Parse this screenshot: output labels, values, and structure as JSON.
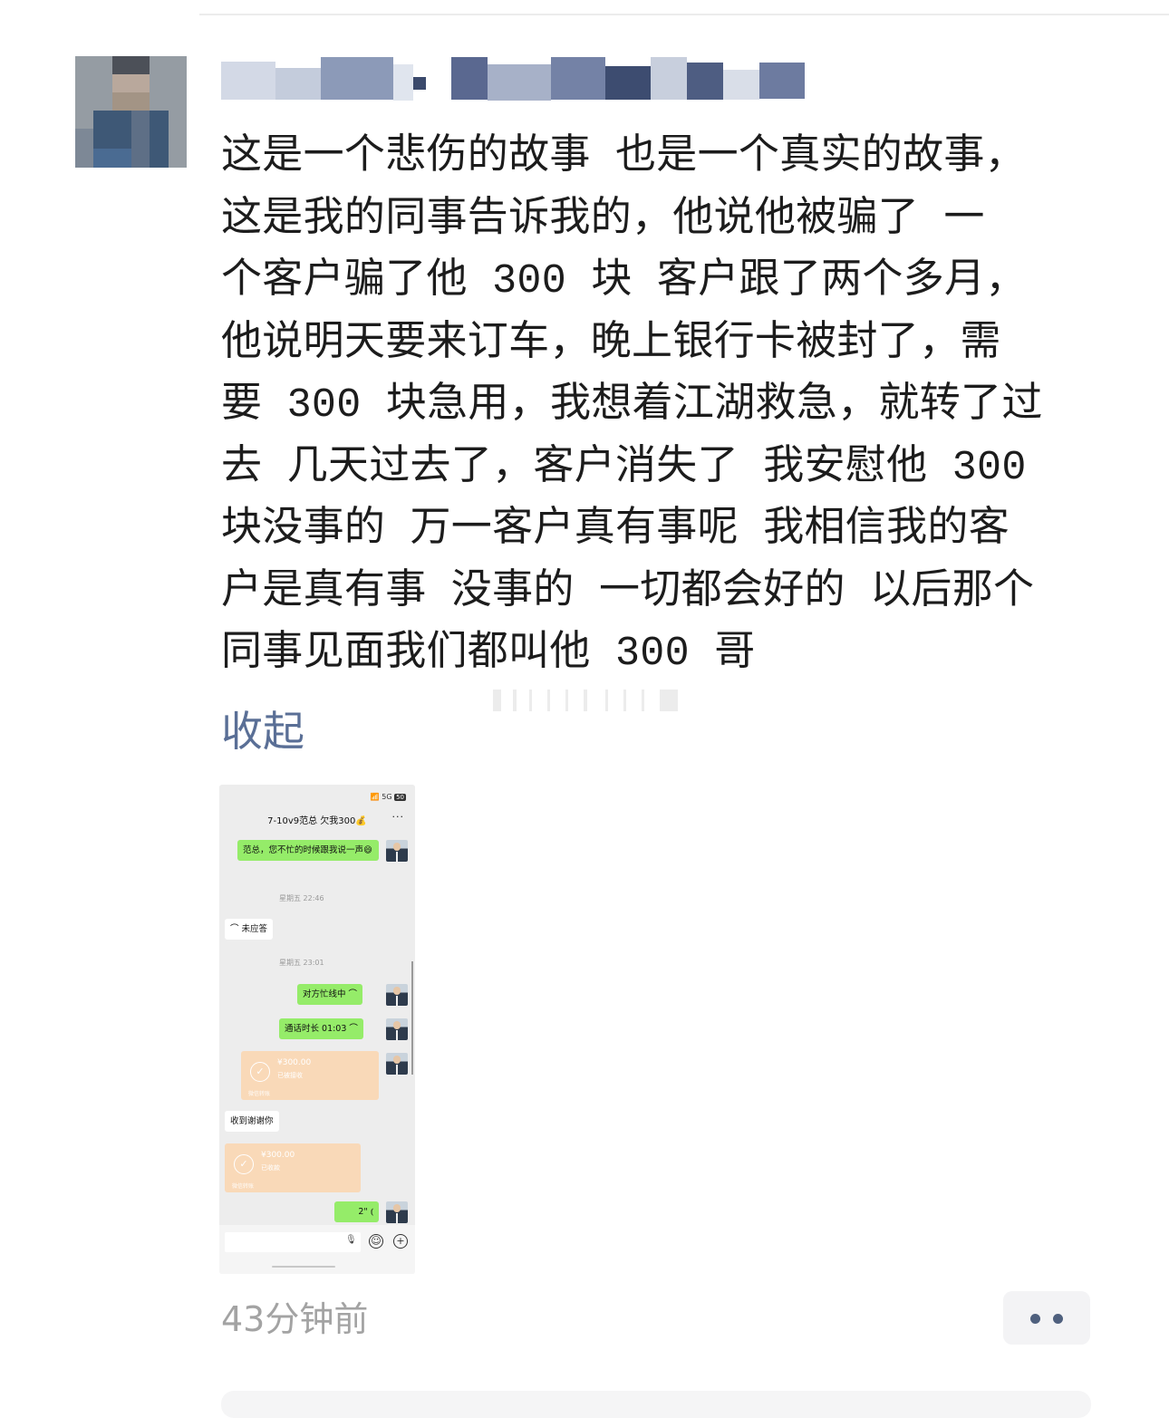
{
  "post": {
    "author_name": "",
    "body": "这是一个悲伤的故事 也是一个真实的故事，\n这是我的同事告诉我的，他说他被骗了 一\n个客户骗了他 300 块 客户跟了两个多月，\n他说明天要来订车，晚上银行卡被封了，需\n要 300 块急用，我想着江湖救急，就转了过\n去 几天过去了，客户消失了 我安慰他 300\n块没事的 万一客户真有事呢 我相信我的客\n户是真有事 没事的 一切都会好的 以后那个\n同事见面我们都叫他 300 哥",
    "collapse_label": "收起",
    "time_ago": "43分钟前",
    "more_icon": "more-dots-icon"
  },
  "screenshot": {
    "status": "📶 5G",
    "battery": "50",
    "chat_title": "7-10v9范总 欠我300💰",
    "more": "···",
    "messages": [
      {
        "side": "right",
        "text": "范总，您不忙的时候跟我说一声😄"
      },
      {
        "type": "time",
        "text": "星期五 22:46"
      },
      {
        "side": "left",
        "text": "⌒ 未应答"
      },
      {
        "type": "time",
        "text": "星期五 23:01"
      },
      {
        "side": "right",
        "text": "对方忙线中 ⌒"
      },
      {
        "side": "right",
        "text": "通话时长 01:03 ⌒"
      },
      {
        "side": "right",
        "type": "transfer",
        "amount": "¥300.00",
        "status": "已被接收",
        "footer": "微信转账"
      },
      {
        "side": "left",
        "text": "收到谢谢你"
      },
      {
        "side": "left",
        "type": "transfer",
        "amount": "¥300.00",
        "status": "已收款",
        "footer": "微信转账"
      },
      {
        "side": "right",
        "text": "2\" ⦅"
      }
    ],
    "input": {
      "mic": "🎙",
      "emoji": "☺",
      "plus": "+"
    }
  },
  "colors": {
    "link": "#5a6f96",
    "chat_green": "#95ec69",
    "transfer": "#f9d9b8",
    "timestamp": "#a3a3a3"
  }
}
